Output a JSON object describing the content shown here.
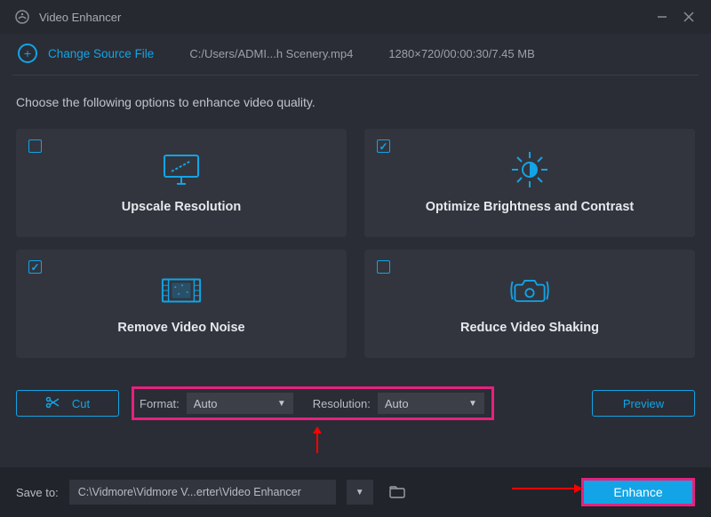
{
  "app": {
    "title": "Video Enhancer"
  },
  "toolbar": {
    "change_label": "Change Source File",
    "file_path": "C:/Users/ADMI...h Scenery.mp4",
    "file_info": "1280×720/00:00:30/7.45 MB"
  },
  "instruction": "Choose the following options to enhance video quality.",
  "cards": {
    "upscale": {
      "label": "Upscale Resolution",
      "checked": false
    },
    "brightness": {
      "label": "Optimize Brightness and Contrast",
      "checked": true
    },
    "noise": {
      "label": "Remove Video Noise",
      "checked": true
    },
    "shaking": {
      "label": "Reduce Video Shaking",
      "checked": false
    }
  },
  "controls": {
    "cut_label": "Cut",
    "format_label": "Format:",
    "format_value": "Auto",
    "resolution_label": "Resolution:",
    "resolution_value": "Auto",
    "preview_label": "Preview"
  },
  "footer": {
    "save_label": "Save to:",
    "save_path": "C:\\Vidmore\\Vidmore V...erter\\Video Enhancer",
    "enhance_label": "Enhance"
  }
}
